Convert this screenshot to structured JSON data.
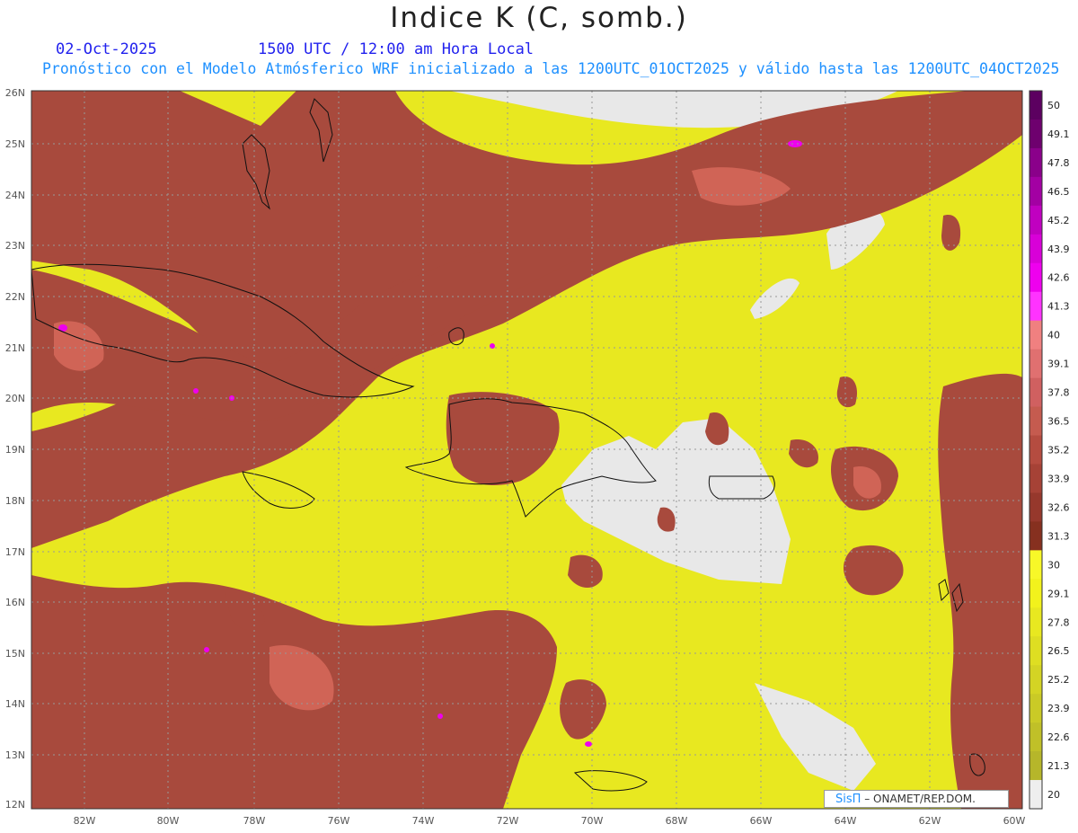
{
  "header": {
    "title": "Indice K (C, somb.)",
    "date": "02-Oct-2025",
    "time": "1500 UTC / 12:00 am Hora Local",
    "subtitle": "Pronóstico con el Modelo Atmósferico WRF inicializado a las 1200UTC_01OCT2025 y válido hasta las  1200UTC_04OCT2025"
  },
  "map": {
    "lat_labels": [
      "26N",
      "25N",
      "24N",
      "23N",
      "22N",
      "21N",
      "20N",
      "19N",
      "18N",
      "17N",
      "16N",
      "15N",
      "14N",
      "13N",
      "12N"
    ],
    "lon_labels": [
      "82W",
      "80W",
      "78W",
      "76W",
      "74W",
      "72W",
      "70W",
      "68W",
      "66W",
      "64W",
      "62W",
      "60W"
    ]
  },
  "colorbar": {
    "labels": [
      "50",
      "49.1",
      "47.8",
      "46.5",
      "45.2",
      "43.9",
      "42.6",
      "41.3",
      "40",
      "39.1",
      "37.8",
      "36.5",
      "35.2",
      "33.9",
      "32.6",
      "31.3",
      "30",
      "29.1",
      "27.8",
      "26.5",
      "25.2",
      "23.9",
      "22.6",
      "21.3",
      "20"
    ],
    "colors": [
      "#5c0060",
      "#6e006e",
      "#8a008a",
      "#a300a3",
      "#c000c0",
      "#d800d8",
      "#ee00ee",
      "#ff33ff",
      "#f08080",
      "#e07070",
      "#d06060",
      "#c55b4f",
      "#b54c40",
      "#a64236",
      "#96382c",
      "#86301f",
      "#f8f828",
      "#f2f21c",
      "#e8e820",
      "#dede22",
      "#d4d424",
      "#caca26",
      "#c0c028",
      "#b6b62a",
      "#eeeeee"
    ]
  },
  "credit": {
    "sis": "SisΠ",
    "rest": " – ONAMET/REP.DOM."
  }
}
